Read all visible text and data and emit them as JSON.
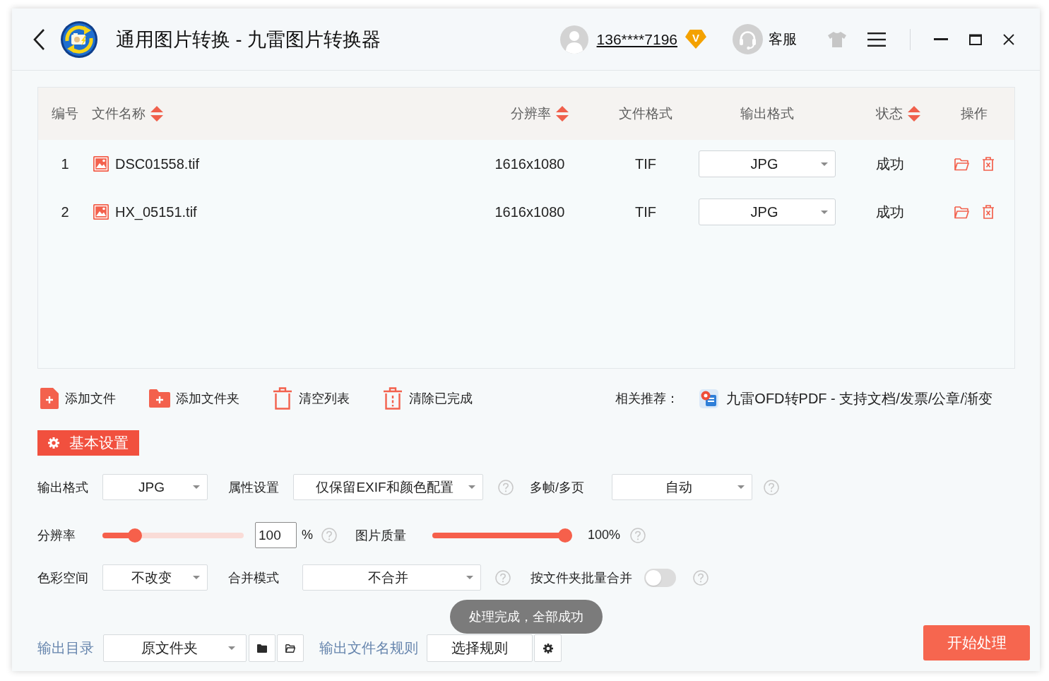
{
  "window": {
    "title": "通用图片转换 - 九雷图片转换器"
  },
  "header": {
    "account": "136****7196",
    "vip_badge": "V",
    "support": "客服"
  },
  "table": {
    "columns": [
      {
        "label": "编号",
        "sortable": false
      },
      {
        "label": "文件名称",
        "sortable": true
      },
      {
        "label": "分辨率",
        "sortable": true
      },
      {
        "label": "文件格式",
        "sortable": false
      },
      {
        "label": "输出格式",
        "sortable": false
      },
      {
        "label": "状态",
        "sortable": true
      },
      {
        "label": "操作",
        "sortable": false
      }
    ],
    "rows": [
      {
        "number": "1",
        "file_name": "DSC01558.tif",
        "resolution": "1616x1080",
        "format": "TIF",
        "output_format": "JPG",
        "status": "成功"
      },
      {
        "number": "2",
        "file_name": "HX_05151.tif",
        "resolution": "1616x1080",
        "format": "TIF",
        "output_format": "JPG",
        "status": "成功"
      }
    ]
  },
  "toolbar": {
    "actions": [
      {
        "kind": "add-file",
        "label": "添加文件"
      },
      {
        "kind": "add-folder",
        "label": "添加文件夹"
      },
      {
        "kind": "clear-list",
        "label": "清空列表"
      },
      {
        "kind": "clear-done",
        "label": "清除已完成"
      }
    ],
    "recommend_label": "相关推荐：",
    "recommend_link": "九雷OFD转PDF - 支持文档/发票/公章/渐变"
  },
  "settings_tabs": [
    {
      "label": "基本设置",
      "selected": true
    }
  ],
  "settings": {
    "output_format": {
      "label": "输出格式",
      "value": "JPG",
      "help": false
    },
    "attributes": {
      "label": "属性设置",
      "value": "仅保留EXIF和颜色配置",
      "help": true
    },
    "multi_frame": {
      "label": "多帧/多页",
      "value": "自动",
      "help": true
    },
    "resolution": {
      "label": "分辨率",
      "level": 0.2,
      "value": "100",
      "unit": "%",
      "help": true
    },
    "quality": {
      "label": "图片质量",
      "level": 1,
      "reading": "100%",
      "help": true
    },
    "color_space": {
      "label": "色彩空间",
      "value": "不改变",
      "help": false
    },
    "merge_mode": {
      "label": "合并模式",
      "value": "不合并",
      "help": true
    },
    "merge_by_folder": {
      "label": "按文件夹批量合并",
      "on": false,
      "help": true
    }
  },
  "toast": "处理完成，全部成功",
  "output": {
    "dir_label": "输出目录",
    "dir_value": "原文件夹",
    "name_rule_label": "输出文件名规则",
    "name_rule_value": "选择规则"
  },
  "start_button": "开始处理"
}
